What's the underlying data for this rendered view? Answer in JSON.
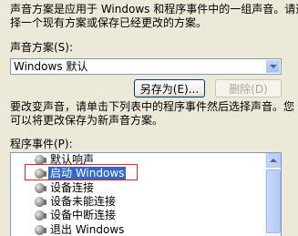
{
  "description": {
    "line1": "声音方案是应用于 Windows 和程序事件中的一组声音。请选",
    "line2": "择一个现有方案或保存已经更改的方案。"
  },
  "scheme": {
    "label": "声音方案(S):",
    "selected": "Windows 默认"
  },
  "buttons": {
    "save_as": "另存为(E)...",
    "delete": "删除(D)"
  },
  "instructions": {
    "line1": "要改变声音，请单击下列表中的程序事件然后选择声音。您",
    "line2": "可以将更改保存为新声音方案。"
  },
  "events": {
    "label": "程序事件(P):",
    "items": [
      {
        "label": "默认响声"
      },
      {
        "label": "启动 Windows"
      },
      {
        "label": "设备连接"
      },
      {
        "label": "设备未能连接"
      },
      {
        "label": "设备中断连接"
      },
      {
        "label": "退出 Windows"
      }
    ]
  },
  "icons": {
    "event": "speaker-icon",
    "dropdown": "chevron-down-icon",
    "scroll_up": "scroll-up-arrow-icon"
  }
}
